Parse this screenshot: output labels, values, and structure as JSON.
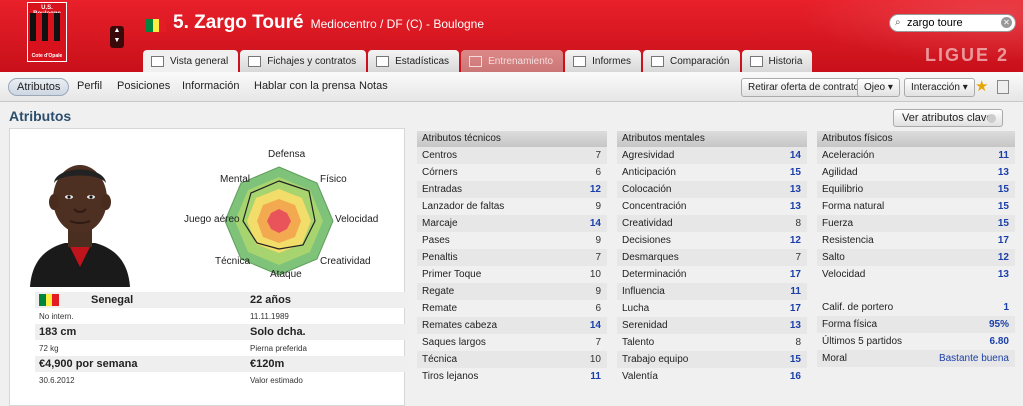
{
  "header": {
    "club_crest": {
      "top": "U.S. Boulogne",
      "bottom": "Cote d'Opale"
    },
    "player_number_name": "5. Zargo Touré",
    "subtitle": "Mediocentro / DF (C) - Boulogne",
    "search_value": "zargo toure",
    "league": "LIGUE 2"
  },
  "tabs": [
    {
      "label": "Vista general",
      "state": "active"
    },
    {
      "label": "Fichajes y contratos",
      "state": "normal"
    },
    {
      "label": "Estadísticas",
      "state": "normal"
    },
    {
      "label": "Entrenamiento",
      "state": "disabled"
    },
    {
      "label": "Informes",
      "state": "normal"
    },
    {
      "label": "Comparación",
      "state": "normal"
    },
    {
      "label": "Historia",
      "state": "normal"
    }
  ],
  "subnav": {
    "items": [
      "Atributos",
      "Perfil",
      "Posiciones",
      "Información",
      "Hablar con la prensa",
      "Notas"
    ],
    "selected": "Atributos",
    "actions": {
      "withdraw": "Retirar oferta de contrato",
      "scout": "Ojeo",
      "interaction": "Interacción"
    }
  },
  "section": {
    "title": "Atributos",
    "key_attrs_button": "Ver atributos clave"
  },
  "radar": {
    "labels": [
      "Defensa",
      "Físico",
      "Velocidad",
      "Creatividad",
      "Ataque",
      "Técnica",
      "Juego aéreo",
      "Mental"
    ]
  },
  "player_info": {
    "nationality": "Senegal",
    "international": "No intern.",
    "height": "183 cm",
    "weight": "72 kg",
    "wage": "€4,900 por semana",
    "contract_end": "30.6.2012",
    "age": "22 años",
    "birthdate": "11.11.1989",
    "foot": "Solo dcha.",
    "foot_label": "Pierna preferida",
    "value": "€120m",
    "value_label": "Valor estimado"
  },
  "technical": {
    "title": "Atributos técnicos",
    "rows": [
      {
        "name": "Centros",
        "value": "7"
      },
      {
        "name": "Córners",
        "value": "6"
      },
      {
        "name": "Entradas",
        "value": "12"
      },
      {
        "name": "Lanzador de faltas",
        "value": "9"
      },
      {
        "name": "Marcaje",
        "value": "14"
      },
      {
        "name": "Pases",
        "value": "9"
      },
      {
        "name": "Penaltis",
        "value": "7"
      },
      {
        "name": "Primer Toque",
        "value": "10"
      },
      {
        "name": "Regate",
        "value": "9"
      },
      {
        "name": "Remate",
        "value": "6"
      },
      {
        "name": "Remates cabeza",
        "value": "14"
      },
      {
        "name": "Saques largos",
        "value": "7"
      },
      {
        "name": "Técnica",
        "value": "10"
      },
      {
        "name": "Tiros lejanos",
        "value": "11"
      }
    ]
  },
  "mental": {
    "title": "Atributos mentales",
    "rows": [
      {
        "name": "Agresividad",
        "value": "14"
      },
      {
        "name": "Anticipación",
        "value": "15"
      },
      {
        "name": "Colocación",
        "value": "13"
      },
      {
        "name": "Concentración",
        "value": "13"
      },
      {
        "name": "Creatividad",
        "value": "8"
      },
      {
        "name": "Decisiones",
        "value": "12"
      },
      {
        "name": "Desmarques",
        "value": "7"
      },
      {
        "name": "Determinación",
        "value": "17"
      },
      {
        "name": "Influencia",
        "value": "11"
      },
      {
        "name": "Lucha",
        "value": "17"
      },
      {
        "name": "Serenidad",
        "value": "13"
      },
      {
        "name": "Talento",
        "value": "8"
      },
      {
        "name": "Trabajo equipo",
        "value": "15"
      },
      {
        "name": "Valentía",
        "value": "16"
      }
    ]
  },
  "physical": {
    "title": "Atributos físicos",
    "rows": [
      {
        "name": "Aceleración",
        "value": "11"
      },
      {
        "name": "Agilidad",
        "value": "13"
      },
      {
        "name": "Equilibrio",
        "value": "15"
      },
      {
        "name": "Forma natural",
        "value": "15"
      },
      {
        "name": "Fuerza",
        "value": "15"
      },
      {
        "name": "Resistencia",
        "value": "17"
      },
      {
        "name": "Salto",
        "value": "12"
      },
      {
        "name": "Velocidad",
        "value": "13"
      }
    ],
    "extra": [
      {
        "name": "Calif. de portero",
        "value": "1"
      },
      {
        "name": "Forma física",
        "value": "95%"
      },
      {
        "name": "Últimos 5 partidos",
        "value": "6.80"
      },
      {
        "name": "Moral",
        "value": "Bastante buena"
      }
    ]
  },
  "colors": {
    "header_red": "#d8141e",
    "value_blue": "#1b3fa8",
    "section_title": "#2c4e6e"
  }
}
